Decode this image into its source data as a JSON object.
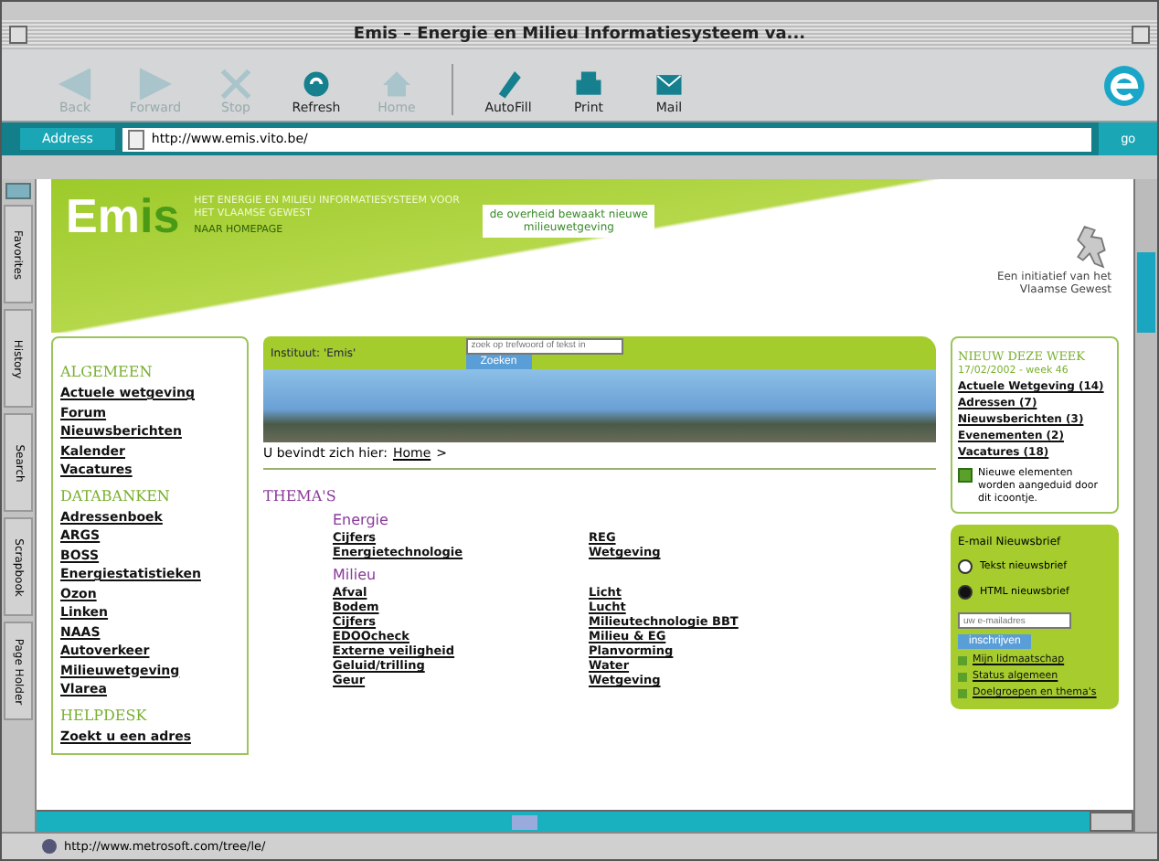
{
  "window": {
    "title": "Emis – Energie en Milieu Informatiesysteem va..."
  },
  "toolbar": [
    {
      "label": "Back",
      "disabled": true
    },
    {
      "label": "Forward",
      "disabled": true
    },
    {
      "label": "Stop",
      "disabled": true
    },
    {
      "label": "Refresh",
      "disabled": false
    },
    {
      "label": "Home",
      "disabled": true
    },
    {
      "label": "AutoFill",
      "disabled": false
    },
    {
      "label": "Print",
      "disabled": false
    },
    {
      "label": "Mail",
      "disabled": false
    }
  ],
  "address_bar": {
    "label": "Address",
    "value": "http://www.emis.vito.be/",
    "go": "go"
  },
  "explorer_tabs": [
    "Favorites",
    "History",
    "Search",
    "Scrapbook",
    "Page Holder"
  ],
  "header": {
    "logo_start": "Em",
    "logo_end": "is",
    "tagline": "HET ENERGIE EN MILIEU INFORMATIESYSTEEM VOOR HET VLAAMSE GEWEST",
    "subline": "NAAR HOMEPAGE",
    "slogan": "de overheid bewaakt nieuwe milieuwetgeving",
    "sponsor": "Een initiatief van het Vlaamse Gewest"
  },
  "left_nav": [
    {
      "heading": "ALGEMEEN",
      "items": [
        "Actuele wetgeving",
        "Forum",
        "Nieuwsberichten",
        "Kalender",
        "Vacatures"
      ]
    },
    {
      "heading": "DATABANKEN",
      "items": [
        "Adressenboek",
        "ARGS",
        "BOSS",
        "Energiestatistieken",
        "Ozon",
        "Linken",
        "NAAS",
        "Autoverkeer",
        "Milieuwetgeving",
        "Vlarea"
      ]
    },
    {
      "heading": "HELPDESK",
      "items": [
        "Zoekt u een adres"
      ]
    }
  ],
  "content": {
    "banner": "Instituut: 'Emis'",
    "search": {
      "placeholder": "zoek op trefwoord of tekst in",
      "button": "Zoeken"
    },
    "breadcrumb": {
      "text": "U bevindt zich hier:",
      "link": "Home",
      "separator": ">"
    },
    "heading": "THEMA'S",
    "themes": [
      {
        "title": "Energie",
        "columns": [
          [
            "Cijfers",
            "Energietechnologie"
          ],
          [
            "REG",
            "Wetgeving"
          ]
        ]
      },
      {
        "title": "Milieu",
        "columns": [
          [
            "Afval",
            "Bodem",
            "Cijfers",
            "EDOOcheck",
            "Externe veiligheid",
            "Geluid/trilling",
            "Geur"
          ],
          [
            "Licht",
            "Lucht",
            "Milieutechnologie BBT",
            "Milieu & EG",
            "Planvorming",
            "Water",
            "Wetgeving"
          ]
        ]
      }
    ]
  },
  "news": {
    "title": "NIEUW DEZE WEEK",
    "date": "17/02/2002 - week 46",
    "items": [
      "Actuele Wetgeving (14)",
      "Adressen (7)",
      "Nieuwsberichten (3)",
      "Evenementen (2)",
      "Vacatures (18)"
    ],
    "legend": "Nieuwe elementen worden aangeduid door dit icoontje."
  },
  "newsletter": {
    "title": "E-mail Nieuwsbrief",
    "options": [
      {
        "label": "Tekst nieuwsbrief",
        "selected": false
      },
      {
        "label": "HTML nieuwsbrief",
        "selected": true
      }
    ],
    "field": {
      "placeholder": "uw e-mailadres"
    },
    "button": "inschrijven",
    "links": [
      "Mijn lidmaatschap",
      "Status algemeen",
      "Doelgroepen en thema's"
    ]
  },
  "status_bar": {
    "text": "http://www.metrosoft.com/tree/le/"
  }
}
